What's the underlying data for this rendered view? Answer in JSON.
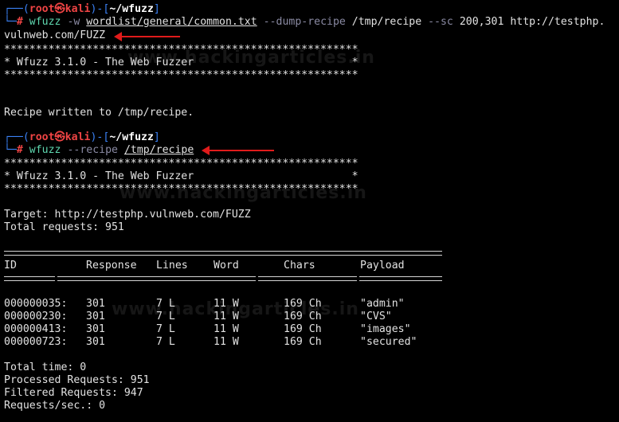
{
  "prompt1": {
    "box_top": "┌──(",
    "user": "root",
    "at": "㉿",
    "host": "kali",
    "sep": ")-[",
    "path": "~/wfuzz",
    "close": "]",
    "box_bottom": "└─",
    "hash": "#",
    "cmd": "wfuzz",
    "flag_w": "-w",
    "wordlist": "wordlist/general/common.txt",
    "flag_dump": "--dump-recipe",
    "recipe_path": "/tmp/recipe",
    "flag_sc": "--sc",
    "codes": "200,301",
    "url_part1": "http://testphp.",
    "url_part2": "vulnweb.com/FUZZ"
  },
  "banner1": {
    "stars": "********************************************************",
    "title": "* Wfuzz 3.1.0 - The Web Fuzzer                         *"
  },
  "recipe_written": "Recipe written to /tmp/recipe.",
  "prompt2": {
    "box_top": "┌──(",
    "user": "root",
    "at": "㉿",
    "host": "kali",
    "sep": ")-[",
    "path": "~/wfuzz",
    "close": "]",
    "box_bottom": "└─",
    "hash": "#",
    "cmd": "wfuzz",
    "flag_recipe": "--recipe",
    "recipe_path": "/tmp/recipe"
  },
  "banner2": {
    "stars": "********************************************************",
    "title": "* Wfuzz 3.1.0 - The Web Fuzzer                         *"
  },
  "target_line": "Target: http://testphp.vulnweb.com/FUZZ",
  "total_requests_line": "Total requests: 951",
  "table": {
    "headers": [
      "ID",
      "Response",
      "Lines",
      "Word",
      "Chars",
      "Payload"
    ],
    "rows": [
      [
        "000000035:",
        "301",
        "7 L",
        "11 W",
        "169 Ch",
        "\"admin\""
      ],
      [
        "000000230:",
        "301",
        "7 L",
        "11 W",
        "169 Ch",
        "\"CVS\""
      ],
      [
        "000000413:",
        "301",
        "7 L",
        "11 W",
        "169 Ch",
        "\"images\""
      ],
      [
        "000000723:",
        "301",
        "7 L",
        "11 W",
        "169 Ch",
        "\"secured\""
      ]
    ]
  },
  "summary": {
    "total_time": "Total time: 0",
    "processed": "Processed Requests: 951",
    "filtered": "Filtered Requests: 947",
    "rate": "Requests/sec.: 0"
  },
  "watermark_text": "www.hackingarticles.in",
  "colors": {
    "background": "#000000",
    "prompt_frame": "#3b82f6",
    "prompt_user": "#ef4444",
    "arrow": "#e01b1b"
  }
}
